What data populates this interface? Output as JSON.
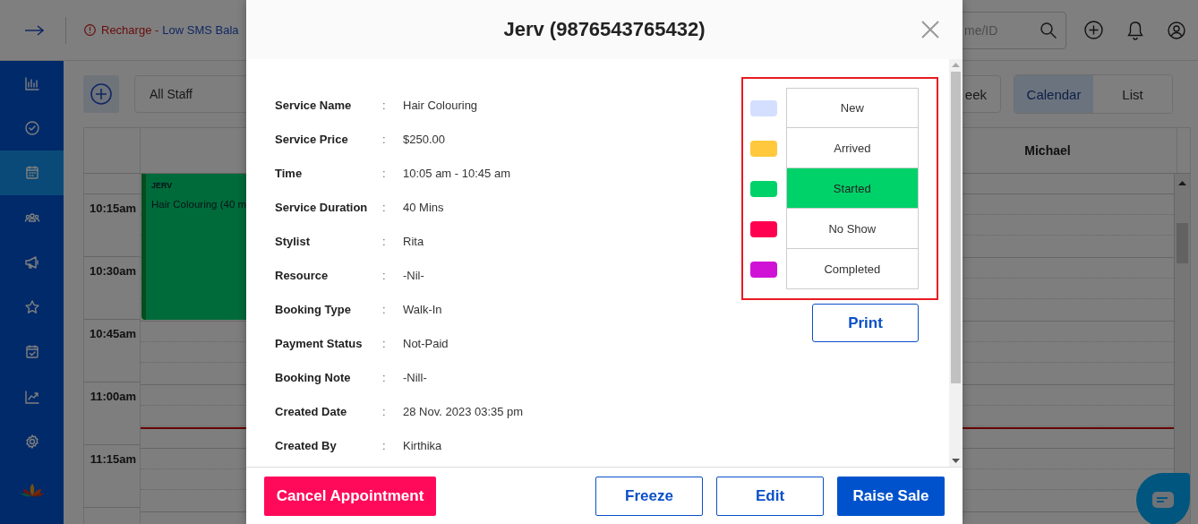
{
  "topbar": {
    "alert": "Recharge -",
    "alert_link": "Low SMS Bala",
    "search": {
      "placeholder": "me/ID"
    }
  },
  "sidebar": {
    "items": [
      {
        "selected": false
      },
      {
        "selected": false
      },
      {
        "selected": true
      },
      {
        "selected": false
      },
      {
        "selected": false
      },
      {
        "selected": false
      },
      {
        "selected": false
      },
      {
        "selected": false
      },
      {
        "selected": false
      }
    ]
  },
  "toolbar": {
    "staff_filter": "All Staff",
    "range_button": "eek",
    "views": [
      {
        "label": "Calendar",
        "selected": true
      },
      {
        "label": "List",
        "selected": false
      }
    ]
  },
  "calendar": {
    "columns": [
      "",
      "Michael"
    ],
    "times": [
      "10:15am",
      "10:30am",
      "10:45am",
      "11:00am",
      "11:15am"
    ],
    "event": {
      "client": "JERV",
      "service": "Hair Colouring (40 m"
    }
  },
  "modal": {
    "title": "Jerv (9876543765432)",
    "details": [
      {
        "label": "Service Name",
        "separator": ":",
        "value": "Hair Colouring"
      },
      {
        "label": "Service Price",
        "separator": ":",
        "value": "$250.00"
      },
      {
        "label": "Time",
        "separator": ":",
        "value": "10:05 am - 10:45 am"
      },
      {
        "label": "Service Duration",
        "separator": ":",
        "value": "40 Mins"
      },
      {
        "label": "Stylist",
        "separator": ":",
        "value": "Rita"
      },
      {
        "label": "Resource",
        "separator": ":",
        "value": "-Nil-"
      },
      {
        "label": "Booking Type",
        "separator": ":",
        "value": "Walk-In"
      },
      {
        "label": "Payment Status",
        "separator": ":",
        "value": "Not-Paid"
      },
      {
        "label": "Booking Note",
        "separator": ":",
        "value": "-Nill-"
      },
      {
        "label": "Created Date",
        "separator": ":",
        "value": "28 Nov. 2023 03:35 pm"
      },
      {
        "label": "Created By",
        "separator": ":",
        "value": "Kirthika"
      }
    ],
    "statuses": [
      {
        "label": "New",
        "color": "#d4deff",
        "selected": false
      },
      {
        "label": "Arrived",
        "color": "#ffc83d",
        "selected": false
      },
      {
        "label": "Started",
        "color": "#00d26a",
        "selected": true
      },
      {
        "label": "No Show",
        "color": "#ff0050",
        "selected": false
      },
      {
        "label": "Completed",
        "color": "#d012d6",
        "selected": false
      }
    ],
    "print": "Print",
    "actions": [
      {
        "label": "Cancel Appointment",
        "kind": "danger"
      },
      {
        "label": "Freeze",
        "kind": "outline"
      },
      {
        "label": "Edit",
        "kind": "outline"
      },
      {
        "label": "Raise Sale",
        "kind": "primary"
      }
    ]
  }
}
